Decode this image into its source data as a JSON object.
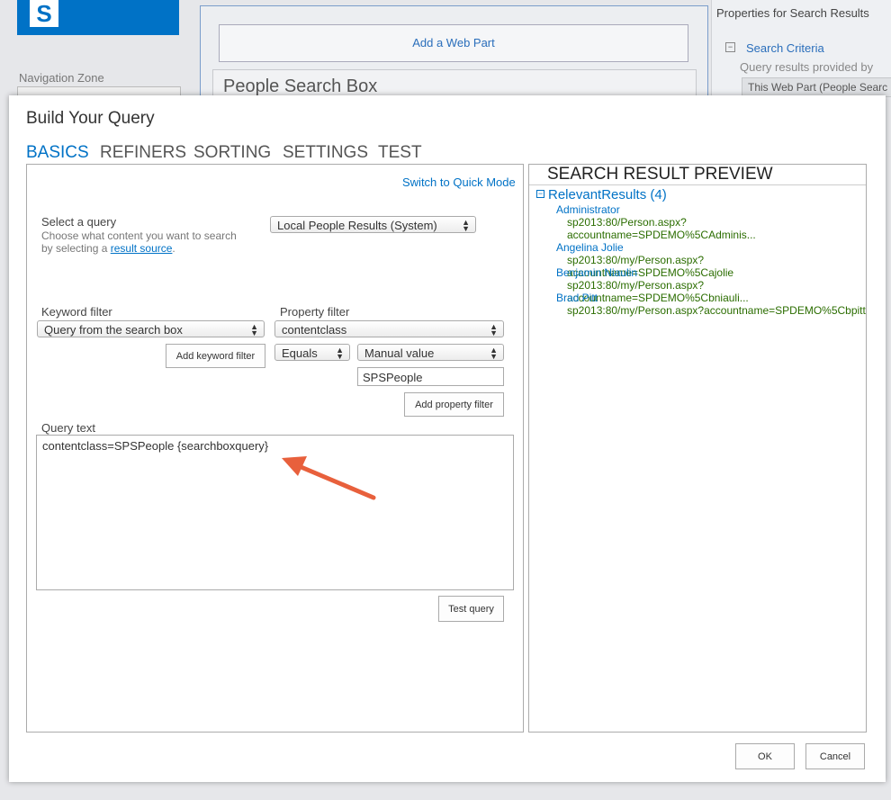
{
  "background": {
    "navigation_zone": "Navigation Zone",
    "add_web_part": "Add a Web Part",
    "people_search_box": "People Search Box",
    "properties_title": "Properties for Search Results",
    "search_criteria": "Search Criteria",
    "query_results_provided_by": "Query results provided by",
    "this_web_part": "This Web Part (People Searc"
  },
  "dialog": {
    "title": "Build Your Query",
    "tabs": [
      "BASICS",
      "REFINERS",
      "SORTING",
      "SETTINGS",
      "TEST"
    ],
    "switch_mode": "Switch to Quick Mode",
    "select_query": {
      "label": "Select a query",
      "hint_line1": "Choose what content you want to search",
      "hint_line2_prefix": "by selecting a ",
      "hint_link": "result source",
      "hint_suffix": ".",
      "value": "Local People Results (System)"
    },
    "keyword_filter": {
      "label": "Keyword filter",
      "value": "Query from the search box",
      "add_button": "Add keyword filter"
    },
    "property_filter": {
      "label": "Property filter",
      "property": "contentclass",
      "operator": "Equals",
      "value_source": "Manual value",
      "value": "SPSPeople",
      "add_button": "Add property filter"
    },
    "query_text": {
      "label": "Query text",
      "value": "contentclass=SPSPeople {searchboxquery}"
    },
    "test_query_button": "Test query",
    "preview": {
      "title": "SEARCH RESULT PREVIEW",
      "group": "RelevantResults (4)",
      "results": [
        {
          "name": "Administrator",
          "url_line1": "sp2013:80/Person.aspx?",
          "url_line2": "accountname=SPDEMO%5CAdminis..."
        },
        {
          "name": "Angelina Jolie",
          "url_line1": "sp2013:80/my/Person.aspx?accountname=SPDEMO%5Cajolie"
        },
        {
          "name": "Benjamin Niaulin",
          "url_line1": "sp2013:80/my/Person.aspx?accountname=SPDEMO%5Cbniauli..."
        },
        {
          "name": "Brad Pitt",
          "url_line1": "sp2013:80/my/Person.aspx?accountname=SPDEMO%5Cbpitt"
        }
      ]
    },
    "ok_button": "OK",
    "cancel_button": "Cancel"
  }
}
